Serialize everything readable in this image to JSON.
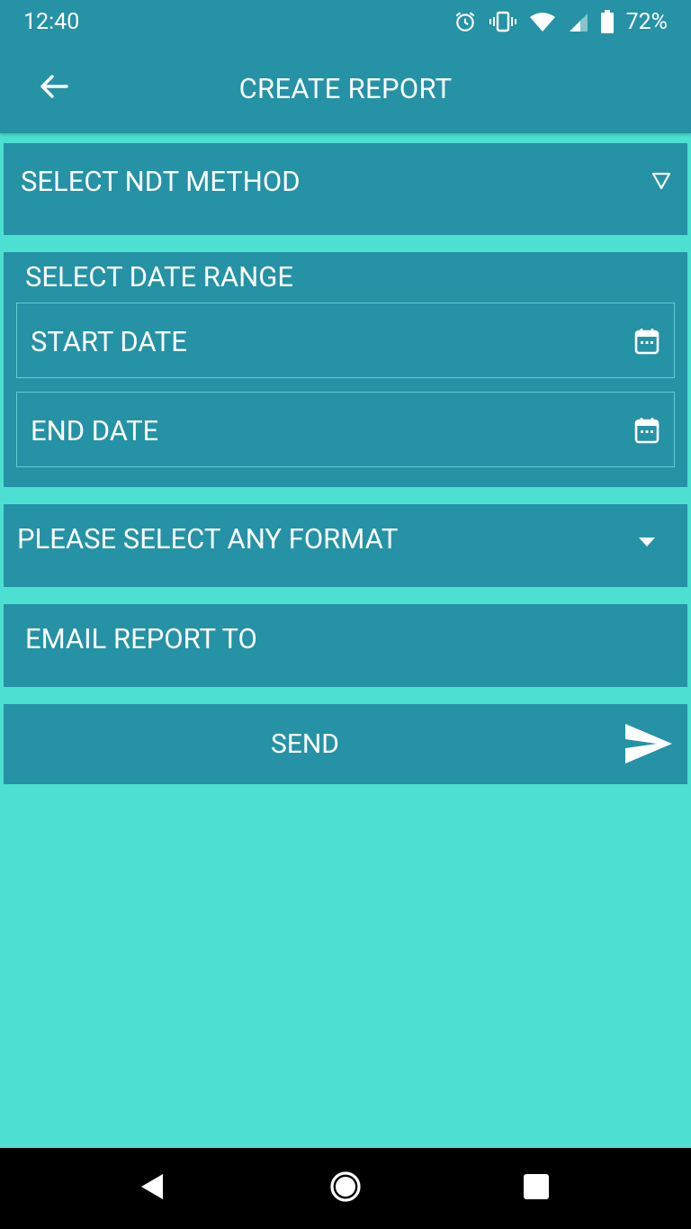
{
  "status": {
    "time": "12:40",
    "battery": "72%"
  },
  "app_bar": {
    "title": "CREATE REPORT",
    "back_icon": "arrow-left-icon"
  },
  "form": {
    "ndt_method": {
      "label": "SELECT NDT METHOD",
      "icon": "triangle-down-outline-icon"
    },
    "date_range": {
      "label": "SELECT DATE RANGE",
      "start_date": {
        "label": "START DATE",
        "icon": "calendar-icon"
      },
      "end_date": {
        "label": "END DATE",
        "icon": "calendar-icon"
      }
    },
    "format": {
      "label": "PLEASE SELECT ANY FORMAT",
      "icon": "caret-down-icon"
    },
    "email": {
      "label": "EMAIL REPORT TO"
    },
    "send": {
      "label": "SEND",
      "icon": "send-icon"
    }
  },
  "colors": {
    "primary": "#2592a6",
    "background": "#4de0d2",
    "text": "#ffffff"
  }
}
